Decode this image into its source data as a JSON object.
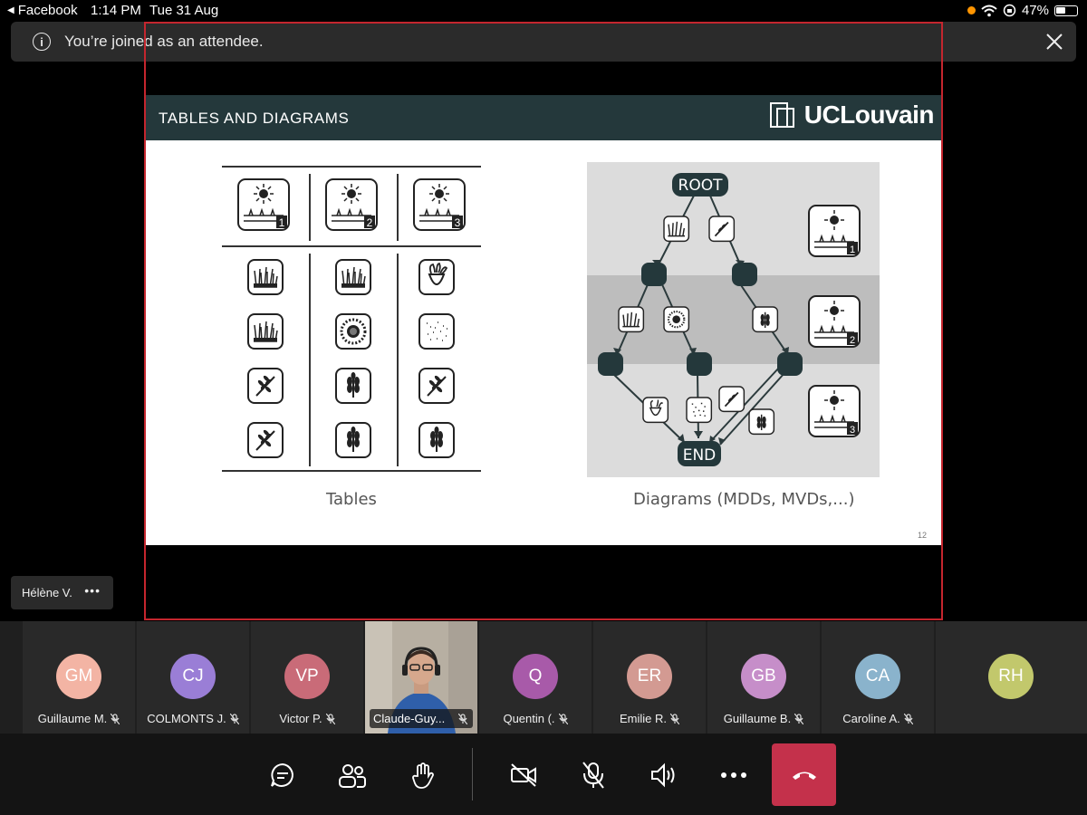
{
  "status_bar": {
    "back_app": "Facebook",
    "time": "1:14 PM",
    "date": "Tue 31 Aug",
    "battery": "47%"
  },
  "banner": {
    "message": "You’re joined as an attendee."
  },
  "slide": {
    "title": "TABLES AND DIAGRAMS",
    "logo_text": "UCLouvain",
    "left_caption": "Tables",
    "right_caption": "Diagrams (MDDs, MVDs,...)",
    "page_number": "12",
    "diagram": {
      "root_label": "ROOT",
      "end_label": "END",
      "scenario_labels": [
        "1",
        "2",
        "3"
      ]
    },
    "table": {
      "header_labels": [
        "1",
        "2",
        "3"
      ],
      "rows": [
        [
          "grass",
          "grass",
          "beet"
        ],
        [
          "grass",
          "sunflower",
          "dots"
        ],
        [
          "wheat",
          "wheat-ear",
          "wheat"
        ],
        [
          "wheat",
          "wheat-ear",
          "wheat-ear"
        ]
      ]
    }
  },
  "presenter": {
    "name": "Hélène V.",
    "more": "•••"
  },
  "participants": [
    {
      "initials": "GM",
      "name": "Guillaume M.",
      "color": "#f3b4a4"
    },
    {
      "initials": "CJ",
      "name": "COLMONTS J.",
      "color": "#9a7ed6"
    },
    {
      "initials": "VP",
      "name": "Victor P.",
      "color": "#c96b78"
    },
    {
      "initials": "",
      "name": "Claude-Guy...",
      "color": "#b9b2a6"
    },
    {
      "initials": "Q",
      "name": "Quentin (.",
      "color": "#a85aa9"
    },
    {
      "initials": "ER",
      "name": "Emilie R.",
      "color": "#d39a92"
    },
    {
      "initials": "GB",
      "name": "Guillaume B.",
      "color": "#c68ec9"
    },
    {
      "initials": "CA",
      "name": "Caroline A.",
      "color": "#8ab3cc"
    },
    {
      "initials": "RH",
      "name": "",
      "color": "#c2c86c"
    }
  ],
  "controls": {
    "chat": "chat-icon",
    "people": "people-icon",
    "raise_hand": "hand-icon",
    "camera": "camera-off-icon",
    "mic": "mic-off-icon",
    "speaker": "speaker-icon",
    "more": "more-icon",
    "hangup": "hangup-icon",
    "hangup_color": "#c4314b"
  }
}
